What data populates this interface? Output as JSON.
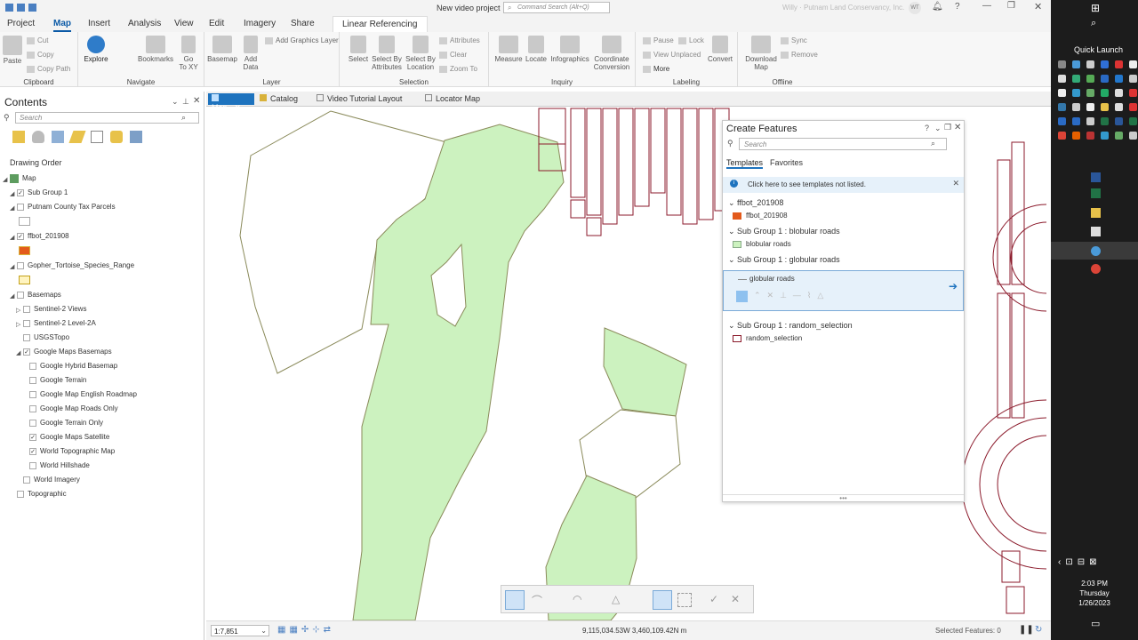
{
  "titlebar": {
    "project_name": "New video project",
    "command_search_placeholder": "Command Search (Alt+Q)",
    "user_text": "Willy · Putnam Land Conservancy, Inc.",
    "user_initials": "WT"
  },
  "ribbon_tabs": [
    "Project",
    "Map",
    "Insert",
    "Analysis",
    "View",
    "Edit",
    "Imagery",
    "Share",
    "Linear Referencing"
  ],
  "ribbon": {
    "clipboard": {
      "label": "Clipboard",
      "paste": "Paste",
      "cut": "Cut",
      "copy": "Copy",
      "copy_path": "Copy Path"
    },
    "navigate": {
      "label": "Navigate",
      "explore": "Explore",
      "bookmarks": "Bookmarks",
      "go_to_xy": "Go\nTo XY"
    },
    "layer": {
      "label": "Layer",
      "basemap": "Basemap",
      "add_data": "Add\nData",
      "add_graphics_layer": "Add Graphics Layer"
    },
    "selection": {
      "label": "Selection",
      "select": "Select",
      "select_by_attributes": "Select By\nAttributes",
      "select_by_location": "Select By\nLocation",
      "attributes": "Attributes",
      "clear": "Clear",
      "zoom_to": "Zoom To"
    },
    "inquiry": {
      "label": "Inquiry",
      "measure": "Measure",
      "locate": "Locate",
      "infographics": "Infographics",
      "coordinate_conversion": "Coordinate\nConversion"
    },
    "labeling": {
      "label": "Labeling",
      "pause": "Pause",
      "lock": "Lock",
      "view_unplaced": "View Unplaced",
      "more": "More",
      "convert": "Convert"
    },
    "offline": {
      "label": "Offline",
      "download_map": "Download\nMap",
      "sync": "Sync",
      "remove": "Remove"
    }
  },
  "contents": {
    "title": "Contents",
    "search_placeholder": "Search",
    "drawing_order": "Drawing Order",
    "items": [
      {
        "label": "Map",
        "checked": true
      },
      {
        "label": "Sub Group 1",
        "checked": true
      },
      {
        "label": "Putnam County Tax Parcels",
        "checked": false
      },
      {
        "label": "ffbot_201908",
        "checked": true
      },
      {
        "label": "Gopher_Tortoise_Species_Range",
        "checked": false
      },
      {
        "label": "Basemaps",
        "checked": false
      },
      {
        "label": "Sentinel-2 Views",
        "checked": false
      },
      {
        "label": "Sentinel-2 Level-2A",
        "checked": false
      },
      {
        "label": "USGSTopo",
        "checked": false
      },
      {
        "label": "Google Maps Basemaps",
        "checked": true
      },
      {
        "label": "Google Hybrid Basemap",
        "checked": false
      },
      {
        "label": "Google Terrain",
        "checked": false
      },
      {
        "label": "Google Map English Roadmap",
        "checked": false
      },
      {
        "label": "Google Map Roads Only",
        "checked": false
      },
      {
        "label": "Google Terrain Only",
        "checked": false
      },
      {
        "label": "Google Maps Satellite",
        "checked": true
      },
      {
        "label": "World Topographic Map",
        "checked": true
      },
      {
        "label": "World Hillshade",
        "checked": false
      },
      {
        "label": "World Imagery",
        "checked": false
      },
      {
        "label": "Topographic",
        "checked": false
      }
    ]
  },
  "view_tabs": [
    "Map",
    "Catalog",
    "Video Tutorial Layout",
    "Locator Map"
  ],
  "create_features": {
    "title": "Create Features",
    "search_placeholder": "Search",
    "tab_templates": "Templates",
    "tab_favorites": "Favorites",
    "info": "Click here to see templates not listed.",
    "sections": [
      {
        "title": "ffbot_201908",
        "item": "ffbot_201908"
      },
      {
        "title": "Sub Group 1 : blobular roads",
        "item": "blobular roads"
      },
      {
        "title": "Sub Group 1 : globular roads",
        "item": "globular roads"
      },
      {
        "title": "Sub Group 1 : random_selection",
        "item": "random_selection"
      }
    ]
  },
  "status": {
    "scale": "1:7,851",
    "coords": "9,115,034.53W 3,460,109.42N m",
    "selected": "Selected Features: 0"
  },
  "taskbar": {
    "quick_launch": "Quick Launch",
    "time": "2:03 PM",
    "day": "Thursday",
    "date": "1/26/2023"
  },
  "colors": {
    "accent": "#1e73be",
    "green_fill": "#ccf2bf",
    "parcel_red": "#8b1a2b",
    "taskbar": "#1c1c1c"
  }
}
